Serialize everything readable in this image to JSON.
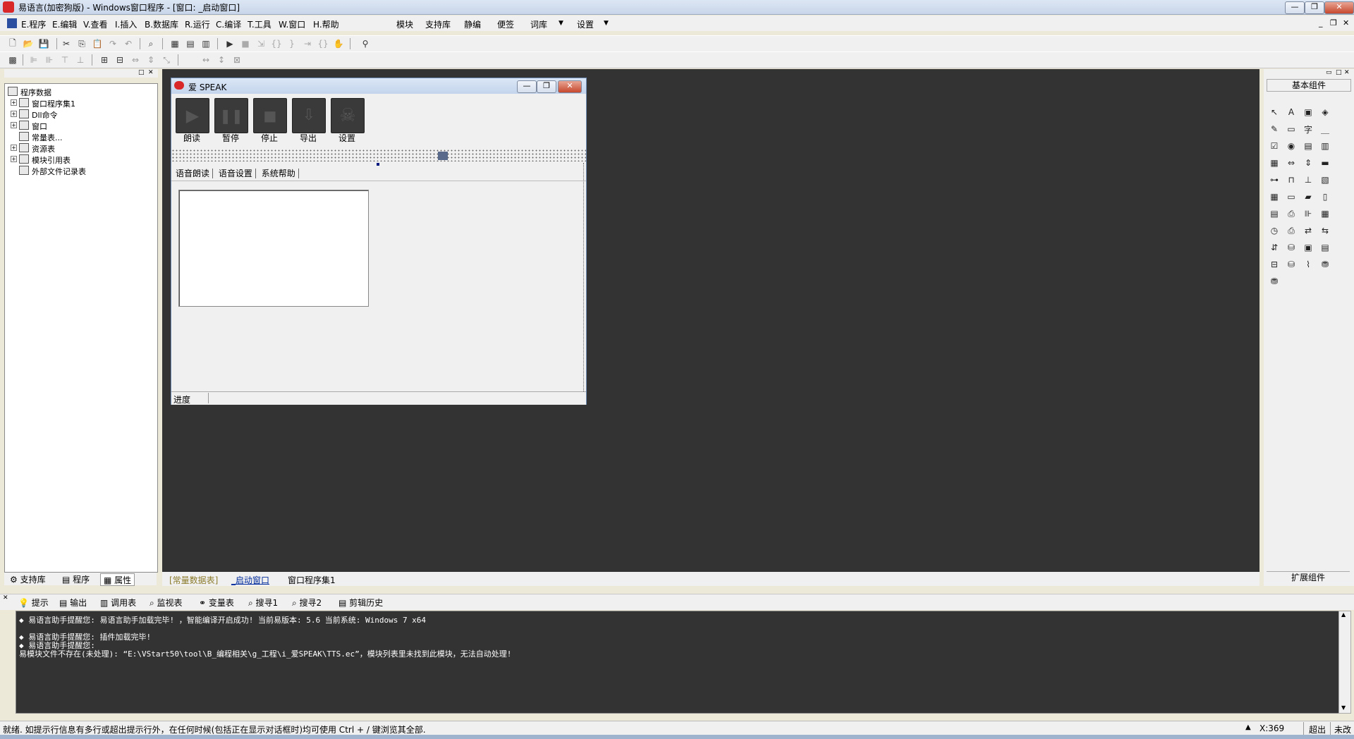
{
  "window": {
    "title": "易语言(加密狗版) - Windows窗口程序 - [窗口: _启动窗口]",
    "minimize": "—",
    "maximize": "❐",
    "close": "✕"
  },
  "menubar": {
    "items": [
      "E.程序",
      "E.编辑",
      "V.查看",
      "I.插入",
      "B.数据库",
      "R.运行",
      "C.编译",
      "T.工具",
      "W.窗口",
      "H.帮助"
    ],
    "extras": [
      "模块",
      "支持库",
      "静编",
      "便签",
      "词库",
      "设置"
    ]
  },
  "left_panel": {
    "tree": [
      {
        "label": "程序数据",
        "level": 0,
        "expand": ""
      },
      {
        "label": "窗口程序集1",
        "level": 1,
        "expand": "+"
      },
      {
        "label": "Dll命令",
        "level": 1,
        "expand": "+"
      },
      {
        "label": "窗口",
        "level": 1,
        "expand": "+"
      },
      {
        "label": "常量表...",
        "level": 1,
        "expand": ""
      },
      {
        "label": "资源表",
        "level": 1,
        "expand": "+"
      },
      {
        "label": "模块引用表",
        "level": 1,
        "expand": "+"
      },
      {
        "label": "外部文件记录表",
        "level": 1,
        "expand": ""
      }
    ],
    "tabs": [
      "支持库",
      "程序",
      "属性"
    ]
  },
  "form": {
    "title": "爱 SPEAK",
    "buttons": [
      {
        "label": "朗读",
        "icon": "play-icon",
        "glyph": "▶"
      },
      {
        "label": "暂停",
        "icon": "pause-icon",
        "glyph": "❚❚"
      },
      {
        "label": "停止",
        "icon": "stop-icon",
        "glyph": "■"
      },
      {
        "label": "导出",
        "icon": "export-icon",
        "glyph": "⇩"
      },
      {
        "label": "设置",
        "icon": "skull-icon",
        "glyph": "☠"
      }
    ],
    "tabs": [
      "语音朗读",
      "语音设置",
      "系统帮助"
    ],
    "status_label": "进度"
  },
  "design_tabs": [
    "[常量数据表]",
    "_启动窗口",
    "窗口程序集1"
  ],
  "right_panel": {
    "header": "基本组件",
    "footer": "扩展组件"
  },
  "output": {
    "tabs": [
      "提示",
      "输出",
      "调用表",
      "监视表",
      "变量表",
      "搜寻1",
      "搜寻2",
      "剪辑历史"
    ],
    "lines": [
      "◆ 易语言助手提醒您: 易语言助手加载完毕! ，智能编译开启成功! 当前易版本: 5.6  当前系统: Windows 7 x64",
      "",
      "◆ 易语言助手提醒您: 插件加载完毕!",
      "◆ 易语言助手提醒您:",
      "易模块文件不存在(未处理): “E:\\VStart50\\tool\\B_编程相关\\g_工程\\i_爱SPEAK\\TTS.ec”，模块列表里未找到此模块，无法自动处理!"
    ]
  },
  "statusbar": {
    "message": "就绪. 如提示行信息有多行或超出提示行外，在任何时候(包括正在显示对话框时)均可使用 Ctrl + / 键浏览其全部.",
    "coord": "X:369",
    "mode": "超出",
    "state": "未改"
  },
  "colors": {
    "design_bg": "#333333",
    "accent": "#d8282a"
  }
}
